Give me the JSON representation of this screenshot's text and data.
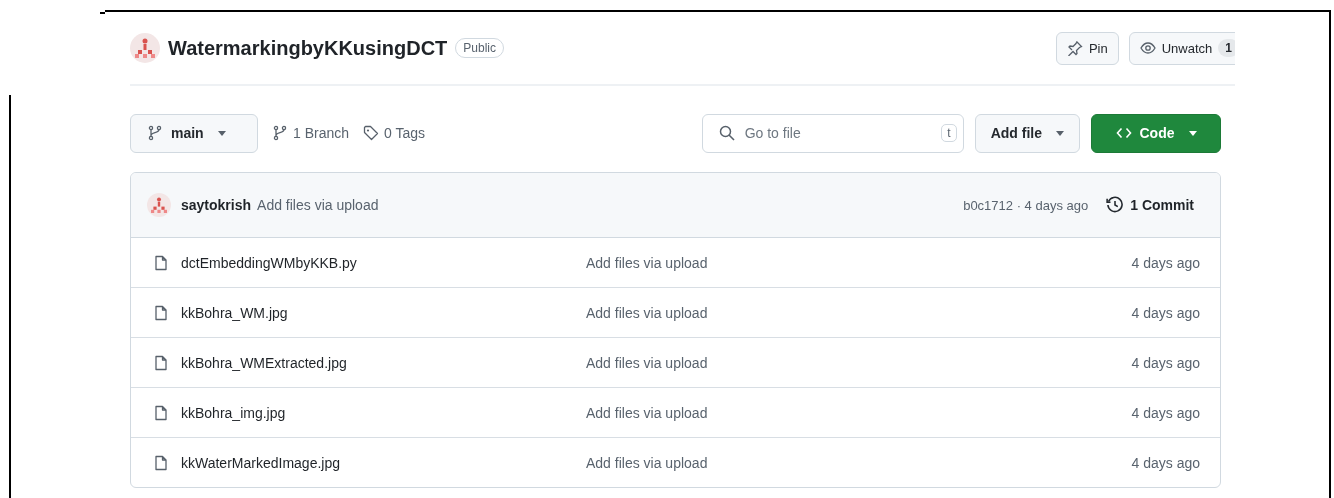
{
  "repo": {
    "name": "WatermarkingbyKKusingDCT",
    "visibility": "Public"
  },
  "actions": [
    {
      "kind": "pin",
      "label": "Pin"
    },
    {
      "kind": "watch",
      "label": "Unwatch",
      "count": "1"
    }
  ],
  "toolbar": {
    "branch": "main",
    "branches": "1 Branch",
    "tags": "0 Tags",
    "search": {
      "placeholder": "Go to file",
      "shortcut": "t"
    },
    "add_file": "Add file",
    "code": "Code"
  },
  "latest_commit": {
    "author": "saytokrish",
    "message": "Add files via upload",
    "hash": "b0c1712",
    "separator": "·",
    "time": "4 days ago",
    "commits": "1 Commit"
  },
  "files": [
    {
      "name": "dctEmbeddingWMbyKKB.py",
      "message": "Add files via upload",
      "time": "4 days ago"
    },
    {
      "name": "kkBohra_WM.jpg",
      "message": "Add files via upload",
      "time": "4 days ago"
    },
    {
      "name": "kkBohra_WMExtracted.jpg",
      "message": "Add files via upload",
      "time": "4 days ago"
    },
    {
      "name": "kkBohra_img.jpg",
      "message": "Add files via upload",
      "time": "4 days ago"
    },
    {
      "name": "kkWaterMarkedImage.jpg",
      "message": "Add files via upload",
      "time": "4 days ago"
    }
  ]
}
